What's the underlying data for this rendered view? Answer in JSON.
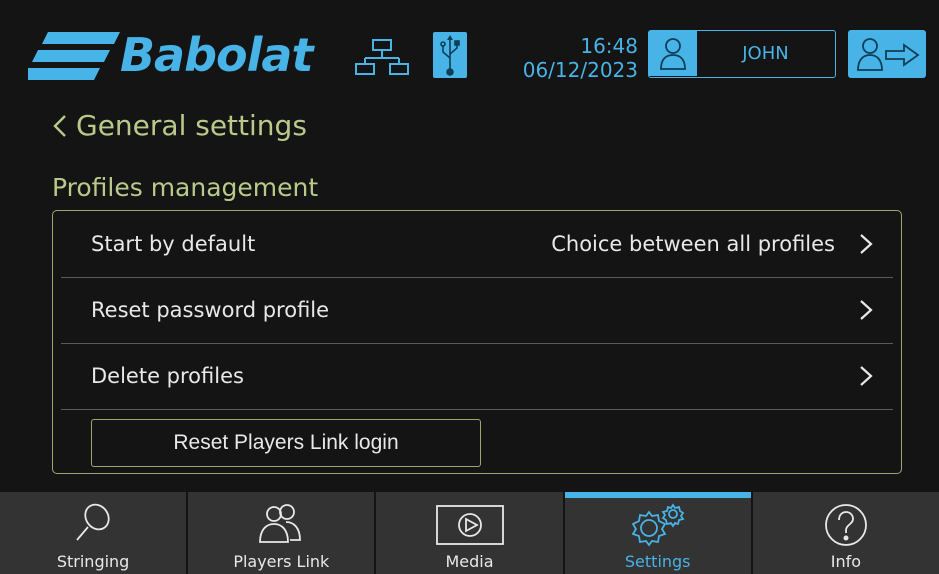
{
  "header": {
    "brand_name": "Babolat",
    "time": "16:48",
    "date": "06/12/2023",
    "user_name": "JOHN"
  },
  "nav_back_label": "General settings",
  "section_title": "Profiles management",
  "settings": {
    "rows": [
      {
        "label": "Start by default",
        "value": "Choice between all profiles"
      },
      {
        "label": "Reset password profile",
        "value": ""
      },
      {
        "label": "Delete profiles",
        "value": ""
      }
    ],
    "reset_button_label": "Reset Players Link login"
  },
  "tabs": [
    {
      "label": "Stringing",
      "icon": "racket-icon"
    },
    {
      "label": "Players Link",
      "icon": "players-icon"
    },
    {
      "label": "Media",
      "icon": "play-icon"
    },
    {
      "label": "Settings",
      "icon": "gears-icon",
      "active": true
    },
    {
      "label": "Info",
      "icon": "question-icon"
    }
  ],
  "colors": {
    "accent": "#47b3e6",
    "title_green": "#b9c98a",
    "panel_border": "#9aa86e",
    "background": "#141414",
    "tab_bg": "#333333"
  }
}
